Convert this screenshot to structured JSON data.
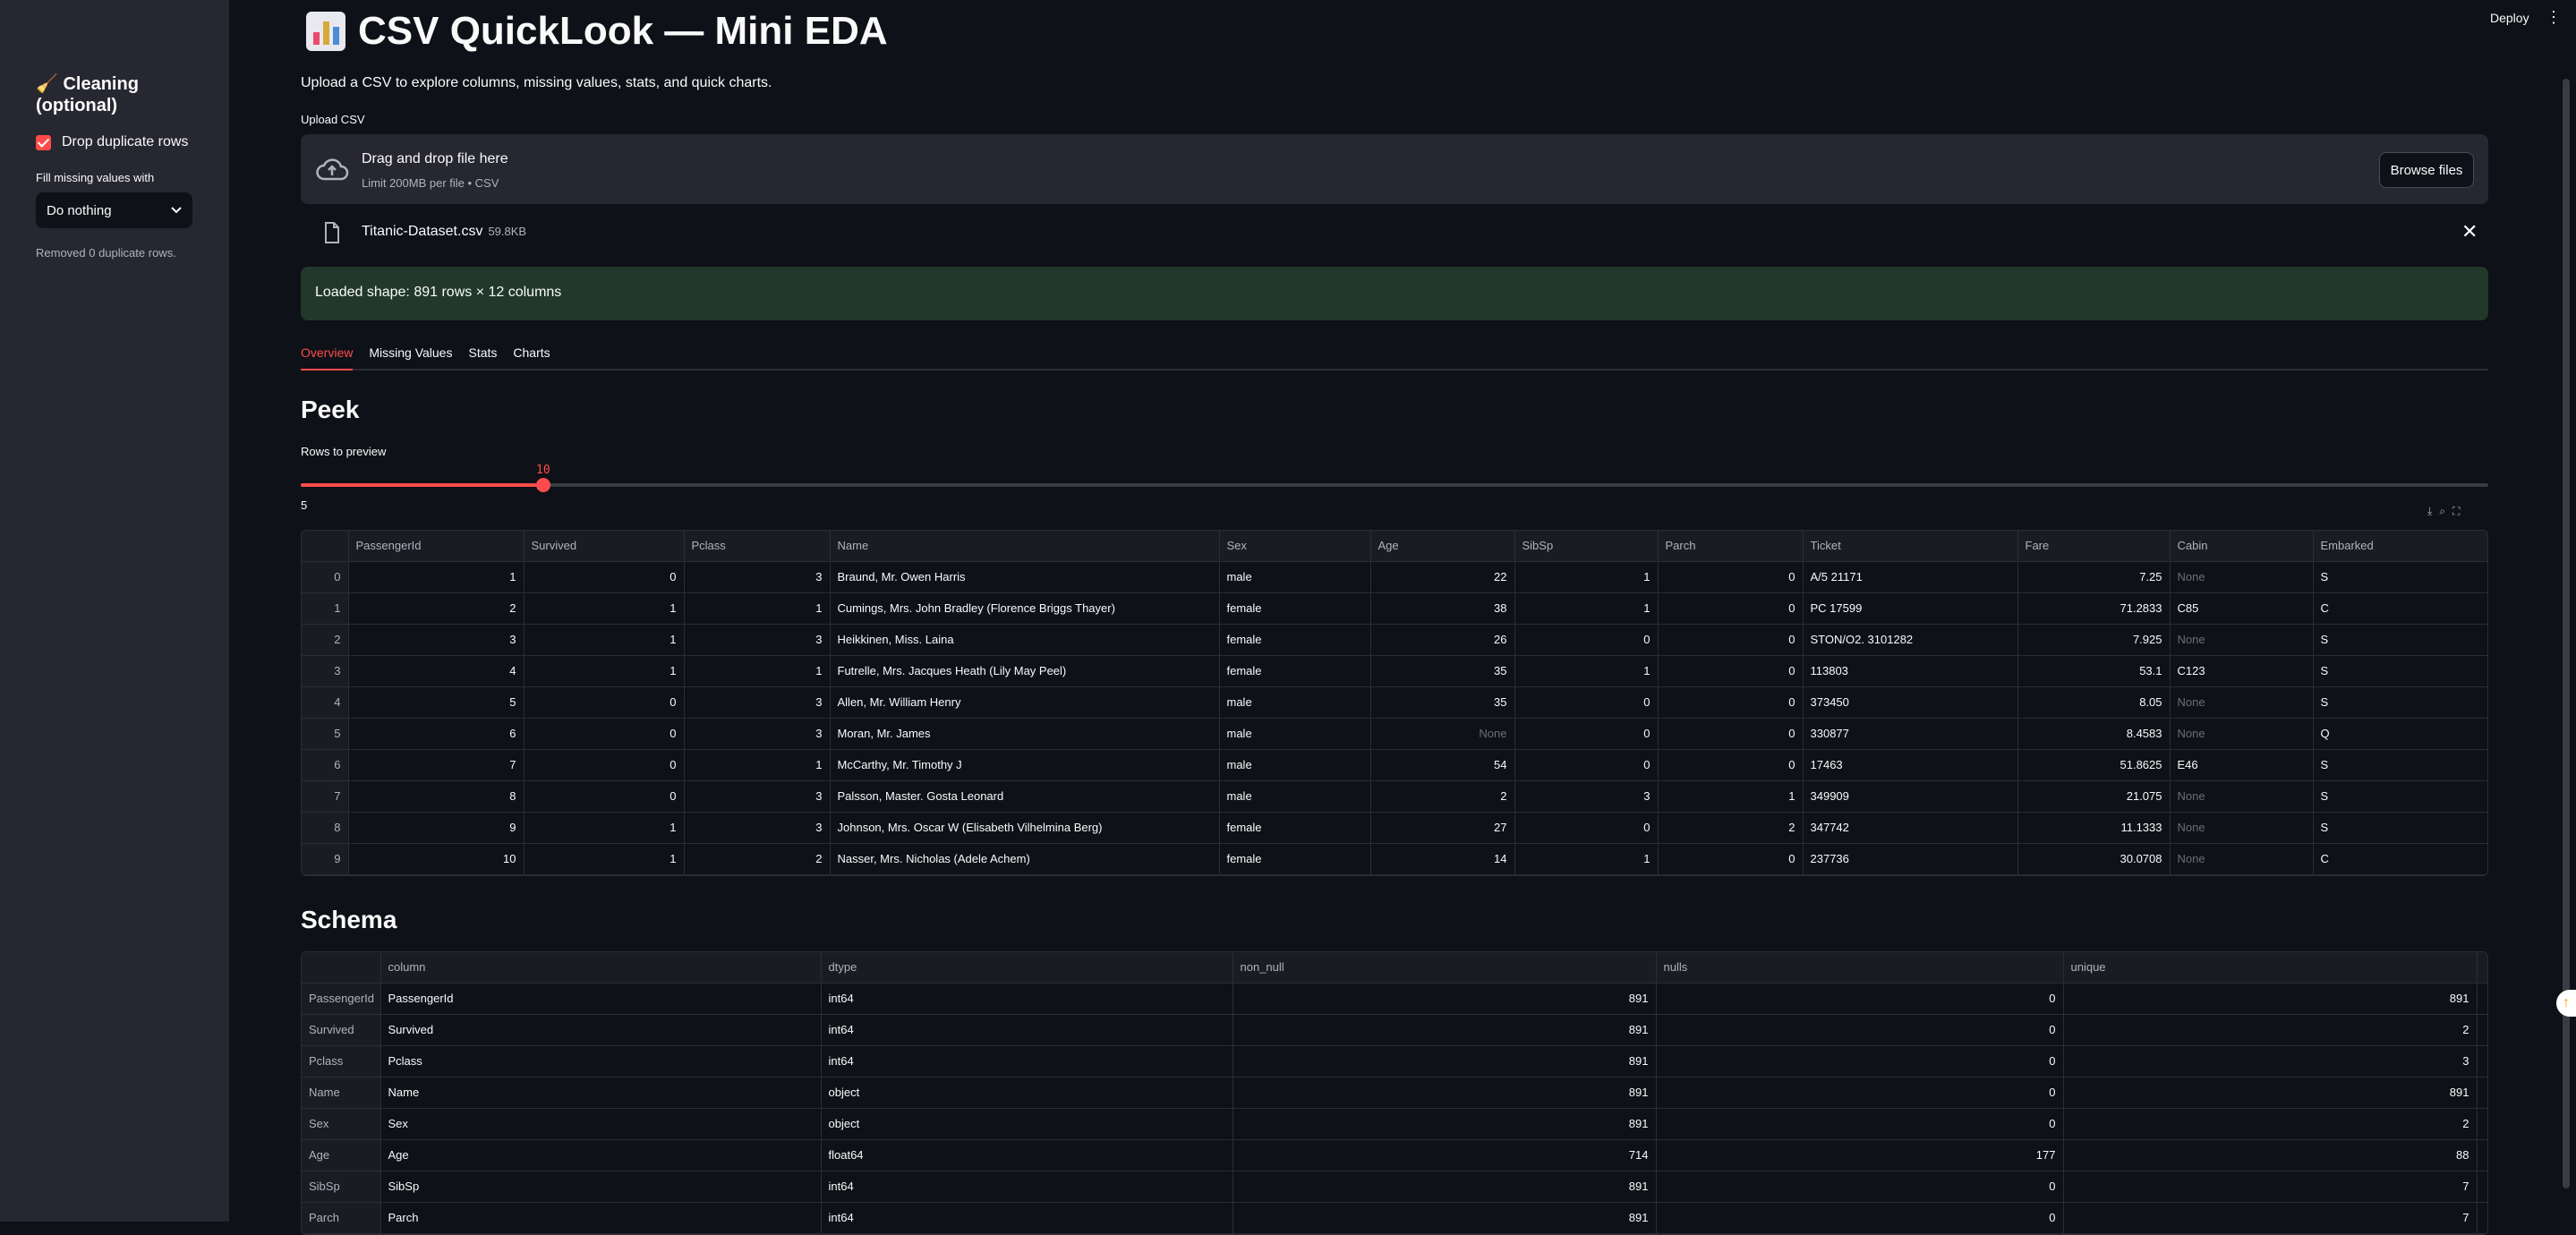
{
  "sidebar": {
    "title": "🧹 Cleaning (optional)",
    "drop_duplicates_label": "Drop duplicate rows",
    "fill_label": "Fill missing values with",
    "fill_value": "Do nothing",
    "note": "Removed 0 duplicate rows."
  },
  "topbar": {
    "deploy": "Deploy",
    "menu": "⋮"
  },
  "header": {
    "title": "CSV QuickLook — Mini EDA",
    "subtitle": "Upload a CSV to explore columns, missing values, stats, and quick charts."
  },
  "upload": {
    "label": "Upload CSV",
    "drop_text": "Drag and drop file here",
    "limit_text": "Limit 200MB per file • CSV",
    "browse_label": "Browse files",
    "file_name": "Titanic-Dataset.csv",
    "file_size": "59.8KB"
  },
  "success_message": "Loaded shape: 891 rows × 12 columns",
  "tabs": [
    "Overview",
    "Missing Values",
    "Stats",
    "Charts"
  ],
  "peek": {
    "heading": "Peek",
    "slider_label": "Rows to preview",
    "slider_value": "10",
    "slider_min": "5",
    "slider_fraction": 0.111,
    "columns": [
      "",
      "PassengerId",
      "Survived",
      "Pclass",
      "Name",
      "Sex",
      "Age",
      "SibSp",
      "Parch",
      "Ticket",
      "Fare",
      "Cabin",
      "Embarked"
    ],
    "rows": [
      [
        "0",
        "1",
        "0",
        "3",
        "Braund, Mr. Owen Harris",
        "male",
        "22",
        "1",
        "0",
        "A/5 21171",
        "7.25",
        "None",
        "S"
      ],
      [
        "1",
        "2",
        "1",
        "1",
        "Cumings, Mrs. John Bradley (Florence Briggs Thayer)",
        "female",
        "38",
        "1",
        "0",
        "PC 17599",
        "71.2833",
        "C85",
        "C"
      ],
      [
        "2",
        "3",
        "1",
        "3",
        "Heikkinen, Miss. Laina",
        "female",
        "26",
        "0",
        "0",
        "STON/O2. 3101282",
        "7.925",
        "None",
        "S"
      ],
      [
        "3",
        "4",
        "1",
        "1",
        "Futrelle, Mrs. Jacques Heath (Lily May Peel)",
        "female",
        "35",
        "1",
        "0",
        "113803",
        "53.1",
        "C123",
        "S"
      ],
      [
        "4",
        "5",
        "0",
        "3",
        "Allen, Mr. William Henry",
        "male",
        "35",
        "0",
        "0",
        "373450",
        "8.05",
        "None",
        "S"
      ],
      [
        "5",
        "6",
        "0",
        "3",
        "Moran, Mr. James",
        "male",
        "None",
        "0",
        "0",
        "330877",
        "8.4583",
        "None",
        "Q"
      ],
      [
        "6",
        "7",
        "0",
        "1",
        "McCarthy, Mr. Timothy J",
        "male",
        "54",
        "0",
        "0",
        "17463",
        "51.8625",
        "E46",
        "S"
      ],
      [
        "7",
        "8",
        "0",
        "3",
        "Palsson, Master. Gosta Leonard",
        "male",
        "2",
        "3",
        "1",
        "349909",
        "21.075",
        "None",
        "S"
      ],
      [
        "8",
        "9",
        "1",
        "3",
        "Johnson, Mrs. Oscar W (Elisabeth Vilhelmina Berg)",
        "female",
        "27",
        "0",
        "2",
        "347742",
        "11.1333",
        "None",
        "S"
      ],
      [
        "9",
        "10",
        "1",
        "2",
        "Nasser, Mrs. Nicholas (Adele Achem)",
        "female",
        "14",
        "1",
        "0",
        "237736",
        "30.0708",
        "None",
        "C"
      ]
    ]
  },
  "schema": {
    "heading": "Schema",
    "columns": [
      "",
      "column",
      "dtype",
      "non_null",
      "nulls",
      "unique"
    ],
    "rows": [
      [
        "PassengerId",
        "PassengerId",
        "int64",
        "891",
        "0",
        "891"
      ],
      [
        "Survived",
        "Survived",
        "int64",
        "891",
        "0",
        "2"
      ],
      [
        "Pclass",
        "Pclass",
        "int64",
        "891",
        "0",
        "3"
      ],
      [
        "Name",
        "Name",
        "object",
        "891",
        "0",
        "891"
      ],
      [
        "Sex",
        "Sex",
        "object",
        "891",
        "0",
        "2"
      ],
      [
        "Age",
        "Age",
        "float64",
        "714",
        "177",
        "88"
      ],
      [
        "SibSp",
        "SibSp",
        "int64",
        "891",
        "0",
        "7"
      ],
      [
        "Parch",
        "Parch",
        "int64",
        "891",
        "0",
        "7"
      ]
    ]
  },
  "colors": {
    "accent": "#ff4b4b",
    "background": "#0e1117",
    "sidebar": "#262730",
    "success": "#21382a"
  }
}
